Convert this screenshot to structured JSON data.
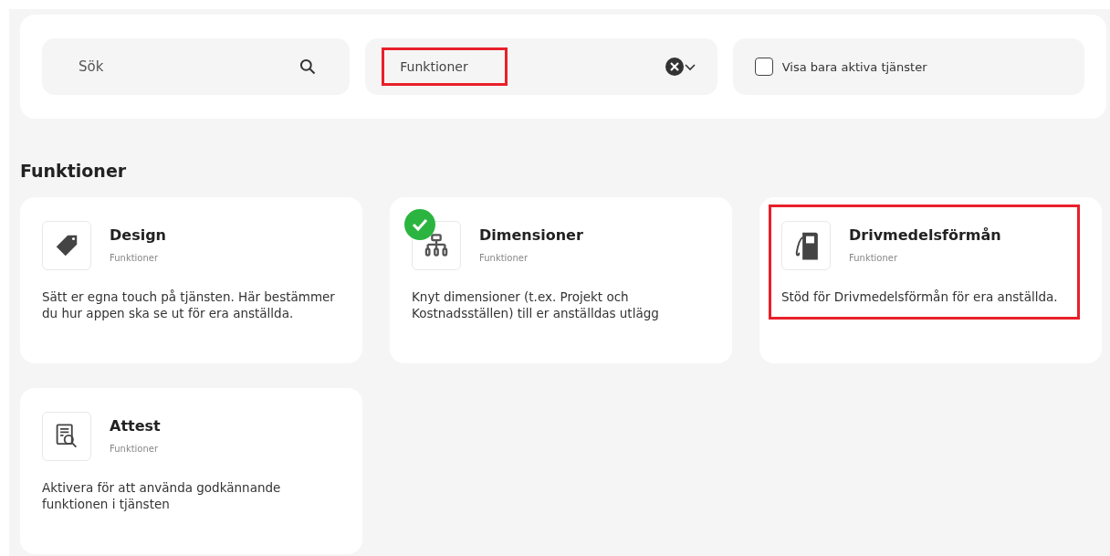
{
  "filters": {
    "search": {
      "placeholder": "Sök"
    },
    "category": {
      "value": "Funktioner",
      "highlighted": true
    },
    "active_only": {
      "label": "Visa bara aktiva tjänster",
      "checked": false
    }
  },
  "section": {
    "title": "Funktioner"
  },
  "services": [
    {
      "kind": "tag",
      "title": "Design",
      "category": "Funktioner",
      "description": "Sätt er egna touch på tjänsten. Här bestämmer du hur appen ska se ut för era anställda.",
      "active": false,
      "highlighted": false
    },
    {
      "kind": "hierarchy",
      "title": "Dimensioner",
      "category": "Funktioner",
      "description": "Knyt dimensioner (t.ex. Projekt och Kostnadsställen) till er anställdas utlägg",
      "active": true,
      "highlighted": false
    },
    {
      "kind": "fuel",
      "title": "Drivmedelsförmån",
      "category": "Funktioner",
      "description": "Stöd för Drivmedelsförmån för era anställda.",
      "active": false,
      "highlighted": true
    },
    {
      "kind": "document-search",
      "title": "Attest",
      "category": "Funktioner",
      "description": "Aktivera för att använda godkännande funktionen i tjänsten",
      "active": false,
      "highlighted": false
    }
  ]
}
